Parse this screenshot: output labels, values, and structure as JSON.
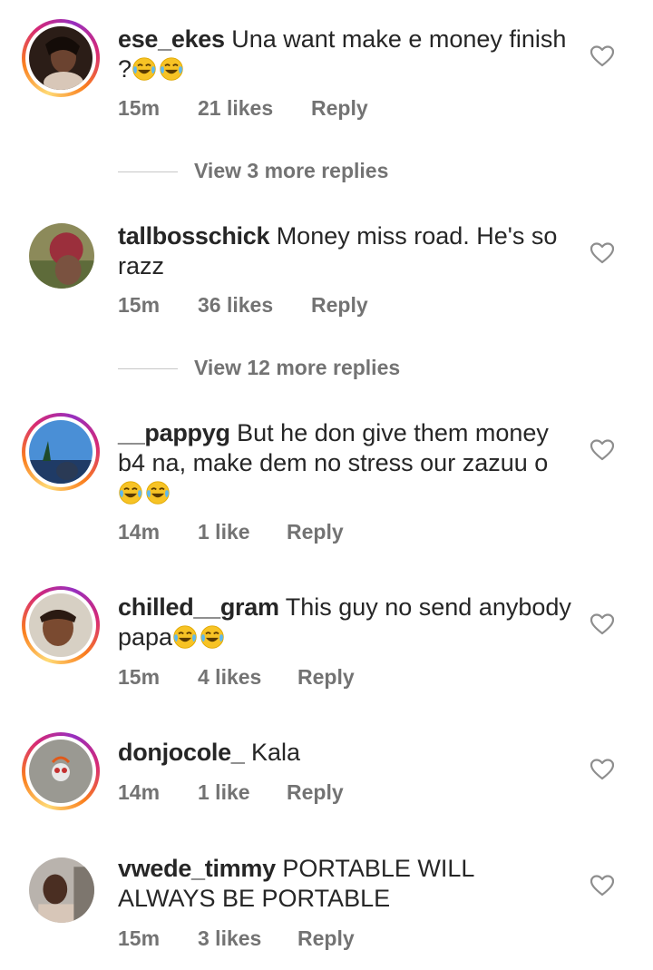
{
  "comments": [
    {
      "username": "ese_ekes",
      "text": "Una want make e money finish ?",
      "emoji_count": 2,
      "time": "15m",
      "likes": "21 likes",
      "reply": "Reply",
      "view_more": "View 3 more replies"
    },
    {
      "username": "tallbosschick",
      "text": "Money miss road. He's so razz",
      "emoji_count": 0,
      "time": "15m",
      "likes": "36 likes",
      "reply": "Reply",
      "view_more": "View 12 more replies"
    },
    {
      "username": "__pappyg",
      "text": "But he don give them money b4 na, make dem no stress our zazuu o",
      "emoji_count": 2,
      "time": "14m",
      "likes": "1 like",
      "reply": "Reply"
    },
    {
      "username": "chilled__gram",
      "text": "This guy no send anybody papa",
      "emoji_count": 2,
      "time": "15m",
      "likes": "4 likes",
      "reply": "Reply"
    },
    {
      "username": "donjocole_",
      "text": "Kala",
      "emoji_count": 0,
      "time": "14m",
      "likes": "1 like",
      "reply": "Reply"
    },
    {
      "username": "vwede_timmy",
      "text": "PORTABLE WILL ALWAYS BE PORTABLE",
      "emoji_count": 0,
      "time": "15m",
      "likes": "3 likes",
      "reply": "Reply"
    }
  ],
  "icons": {
    "like": "heart-outline-icon",
    "emoji": "face-with-tears-of-joy-emoji"
  },
  "colors": {
    "text": "#262626",
    "secondary": "#737373",
    "emoji_face": "#f7c325"
  }
}
